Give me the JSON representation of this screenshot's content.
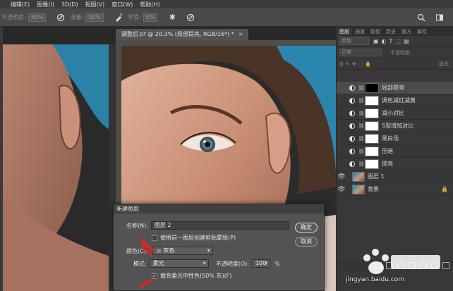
{
  "menubar": {
    "items": [
      "",
      "编辑(E)",
      "图像(I)",
      "3D(D)",
      "视图(V)",
      "窗口(W)",
      "帮助(H)"
    ]
  },
  "options": {
    "opacity_label": "不透明度:",
    "opacity_value": "40%",
    "flow_label": "流量:",
    "flow_value": "50%",
    "smooth_label": "平滑:",
    "smooth_value": "0%"
  },
  "document": {
    "tab_title": "调整后.tif @ 20.3% (局部提亮, RGB/16*) *",
    "close": "×"
  },
  "panel": {
    "tabs": [
      "图层",
      "通道",
      "路径",
      "历史",
      "直方",
      "属性"
    ],
    "filter_placeholder": "类型",
    "blend_mode": "正常",
    "opacity_label": "不透明度:",
    "fill_label": "填充:",
    "layers": [
      {
        "name": "局部提亮",
        "kind": "adjust",
        "mask": "black",
        "visible": false,
        "selected": true
      },
      {
        "name": "调色减红减黄",
        "kind": "adjust",
        "mask": "white",
        "visible": false,
        "selected": false
      },
      {
        "name": "减小对比",
        "kind": "adjust",
        "mask": "white",
        "visible": false,
        "selected": false
      },
      {
        "name": "S型增加对比",
        "kind": "adjust",
        "mask": "white",
        "visible": false,
        "selected": false
      },
      {
        "name": "黑白场",
        "kind": "adjust",
        "mask": "white",
        "visible": false,
        "selected": false
      },
      {
        "name": "压暗",
        "kind": "adjust",
        "mask": "white",
        "visible": false,
        "selected": false
      },
      {
        "name": "提亮",
        "kind": "adjust",
        "mask": "white",
        "visible": false,
        "selected": false
      },
      {
        "name": "图层 1",
        "kind": "pixel",
        "visible": true,
        "selected": false
      },
      {
        "name": "背景",
        "kind": "pixel",
        "visible": true,
        "locked": true,
        "selected": false
      }
    ]
  },
  "dialog": {
    "title": "新建图层",
    "name_label": "名称(N):",
    "name_value": "图层 2",
    "clip_checkbox_label": "使用前一图层创建剪贴蒙版(P)",
    "color_label": "颜色(C):",
    "color_value": "灰色",
    "mode_label": "模式:",
    "mode_value": "柔光",
    "opacity_label": "不透明度(O):",
    "opacity_value": "100",
    "opacity_unit": "%",
    "fill_checkbox_label": "填充柔光中性色(50% 灰)(F)",
    "fill_checked": true,
    "ok_label": "确定",
    "cancel_label": "取消"
  },
  "watermark": {
    "url": "jingyan.baidu.com"
  }
}
